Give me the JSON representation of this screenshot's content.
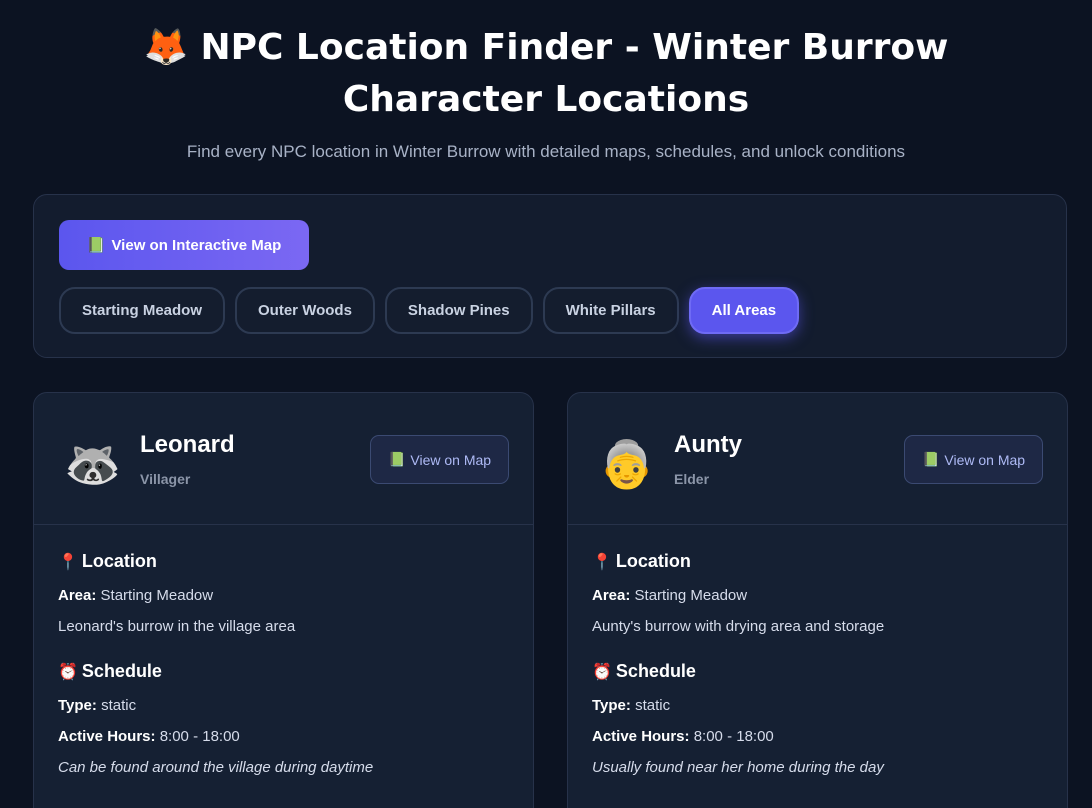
{
  "header": {
    "emoji": "🦊",
    "title": "NPC Location Finder - Winter Burrow Character Locations",
    "subtitle": "Find every NPC location in Winter Burrow with detailed maps, schedules, and unlock conditions"
  },
  "controls": {
    "map_icon": "📗",
    "map_button": "View on Interactive Map",
    "filters": [
      "Starting Meadow",
      "Outer Woods",
      "Shadow Pines",
      "White Pillars",
      "All Areas"
    ],
    "active_filter": "All Areas"
  },
  "npcs": [
    {
      "avatar": "🦝",
      "name": "Leonard",
      "role": "Villager",
      "view_icon": "📗",
      "view_label": "View on Map",
      "location_icon": "📍",
      "location_title": "Location",
      "area_label": "Area:",
      "area": "Starting Meadow",
      "location_desc": "Leonard's burrow in the village area",
      "schedule_icon": "⏰",
      "schedule_title": "Schedule",
      "type_label": "Type:",
      "type": "static",
      "hours_label": "Active Hours:",
      "hours": "8:00 - 18:00",
      "note": "Can be found around the village during daytime"
    },
    {
      "avatar": "👵",
      "name": "Aunty",
      "role": "Elder",
      "view_icon": "📗",
      "view_label": "View on Map",
      "location_icon": "📍",
      "location_title": "Location",
      "area_label": "Area:",
      "area": "Starting Meadow",
      "location_desc": "Aunty's burrow with drying area and storage",
      "schedule_icon": "⏰",
      "schedule_title": "Schedule",
      "type_label": "Type:",
      "type": "static",
      "hours_label": "Active Hours:",
      "hours": "8:00 - 18:00",
      "note": "Usually found near her home during the day"
    }
  ],
  "colors": {
    "background": "#0c1322",
    "panel": "#131c2e",
    "card": "#152033",
    "accent": "#5b56ee",
    "accent_light": "#7b68f3"
  }
}
